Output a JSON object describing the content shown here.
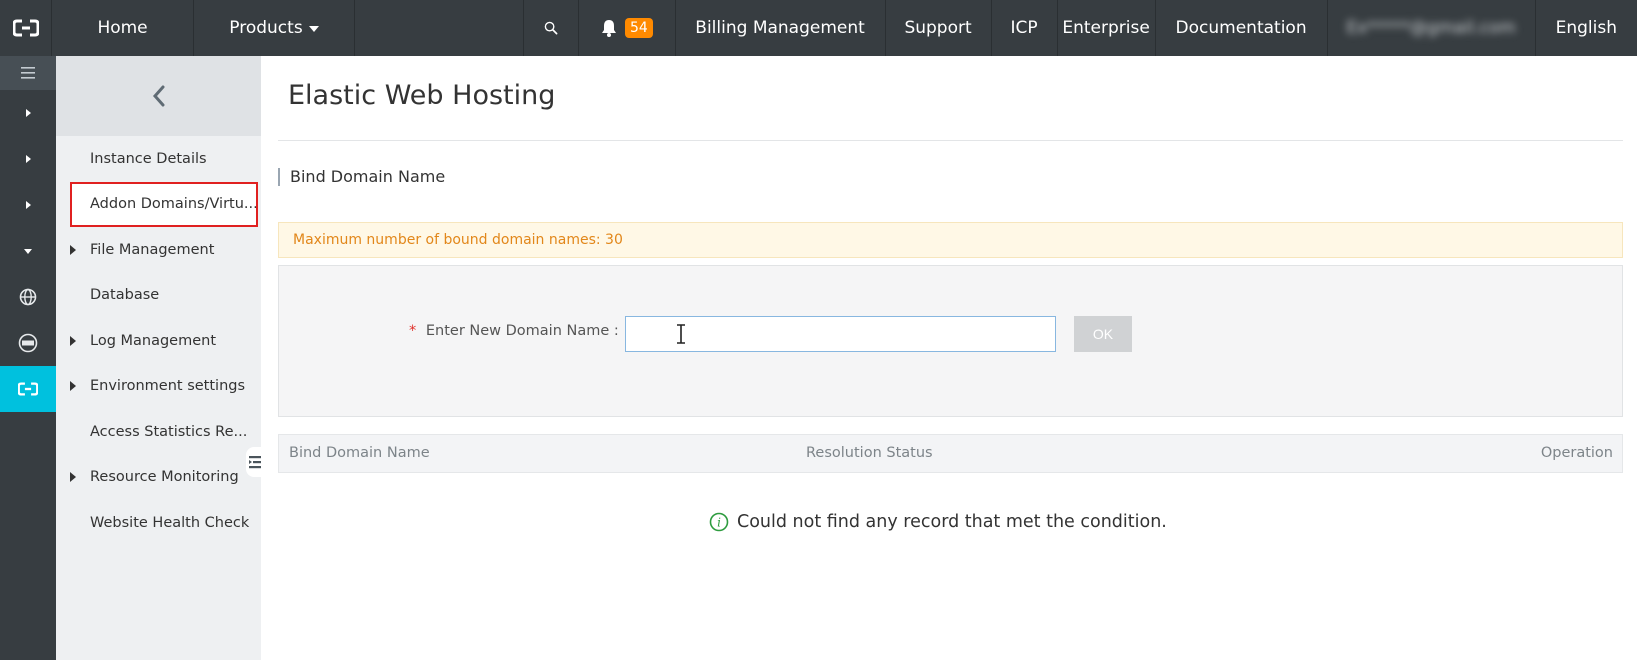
{
  "topbar": {
    "home": "Home",
    "products": "Products",
    "notification_count": "54",
    "billing": "Billing Management",
    "support": "Support",
    "icp": "ICP",
    "enterprise": "Enterprise",
    "documentation": "Documentation",
    "user_account": "Ex*****@gmail.com",
    "language": "English",
    "accent_badge_color": "#ff8a00",
    "bar_color": "#373d41"
  },
  "rail": {
    "icons": [
      "menu-icon",
      "expand-right-icon",
      "expand-right-icon",
      "expand-right-icon",
      "expand-down-icon",
      "globe-icon",
      "dns-icon",
      "hosting-icon"
    ],
    "active_color": "#00c1de"
  },
  "sidebar": {
    "items": [
      {
        "label": "Instance Details",
        "has_children": false
      },
      {
        "label": "Addon Domains/Virtu...",
        "has_children": false,
        "selected": true
      },
      {
        "label": "File Management",
        "has_children": true
      },
      {
        "label": "Database",
        "has_children": false
      },
      {
        "label": "Log Management",
        "has_children": true
      },
      {
        "label": "Environment settings",
        "has_children": true
      },
      {
        "label": "Access Statistics Re...",
        "has_children": false
      },
      {
        "label": "Resource Monitoring",
        "has_children": true
      },
      {
        "label": "Website Health Check",
        "has_children": false
      }
    ]
  },
  "main": {
    "title": "Elastic Web Hosting",
    "section_title": "Bind Domain Name",
    "notice": "Maximum number of bound domain names: 30",
    "form": {
      "label": "Enter New Domain Name :",
      "required_mark": "*",
      "input_value": "",
      "ok_label": "OK"
    },
    "table": {
      "columns": [
        "Bind Domain Name",
        "Resolution Status",
        "Operation"
      ],
      "rows": []
    },
    "empty_message": "Could not find any record that met the condition."
  }
}
